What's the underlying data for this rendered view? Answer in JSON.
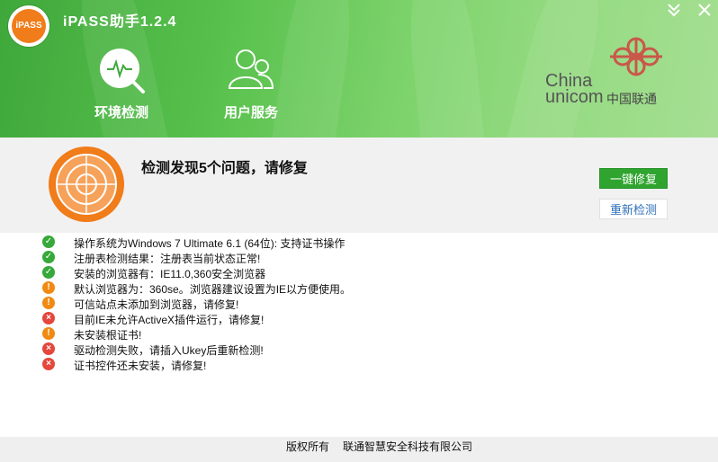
{
  "app": {
    "logo_text": "iPASS",
    "title": "iPASS助手1.2.4"
  },
  "window": {
    "minimize_glyph": "≚",
    "close_glyph": "✕"
  },
  "nav": [
    {
      "label": "环境检测",
      "icon": "monitor-search-icon"
    },
    {
      "label": "用户服务",
      "icon": "users-icon"
    }
  ],
  "brand": {
    "en_line1": "China",
    "en_line2": "unicom",
    "cn": "中国联通"
  },
  "status": {
    "title": "检测发现5个问题，请修复",
    "fix_button": "一键修复",
    "recheck_button": "重新检测"
  },
  "results": [
    {
      "status": "ok",
      "text": "操作系统为Windows 7 Ultimate 6.1 (64位): 支持证书操作"
    },
    {
      "status": "ok",
      "text": "注册表检测结果：注册表当前状态正常!"
    },
    {
      "status": "ok",
      "text": "安装的浏览器有：IE11.0,360安全浏览器"
    },
    {
      "status": "warn",
      "text": "默认浏览器为：360se。浏览器建议设置为IE以方便使用。"
    },
    {
      "status": "warn",
      "text": "可信站点未添加到浏览器，请修复!"
    },
    {
      "status": "err",
      "text": "目前IE未允许ActiveX插件运行，请修复!"
    },
    {
      "status": "warn",
      "text": "未安装根证书!"
    },
    {
      "status": "err",
      "text": "驱动检测失败，请插入Ukey后重新检测!"
    },
    {
      "status": "err",
      "text": "证书控件还未安装，请修复!"
    }
  ],
  "footer": {
    "copyright": "版权所有",
    "company": "联通智慧安全科技有限公司"
  },
  "colors": {
    "green": "#2fa42f",
    "orange": "#f07c1a",
    "red": "#e5473c"
  }
}
